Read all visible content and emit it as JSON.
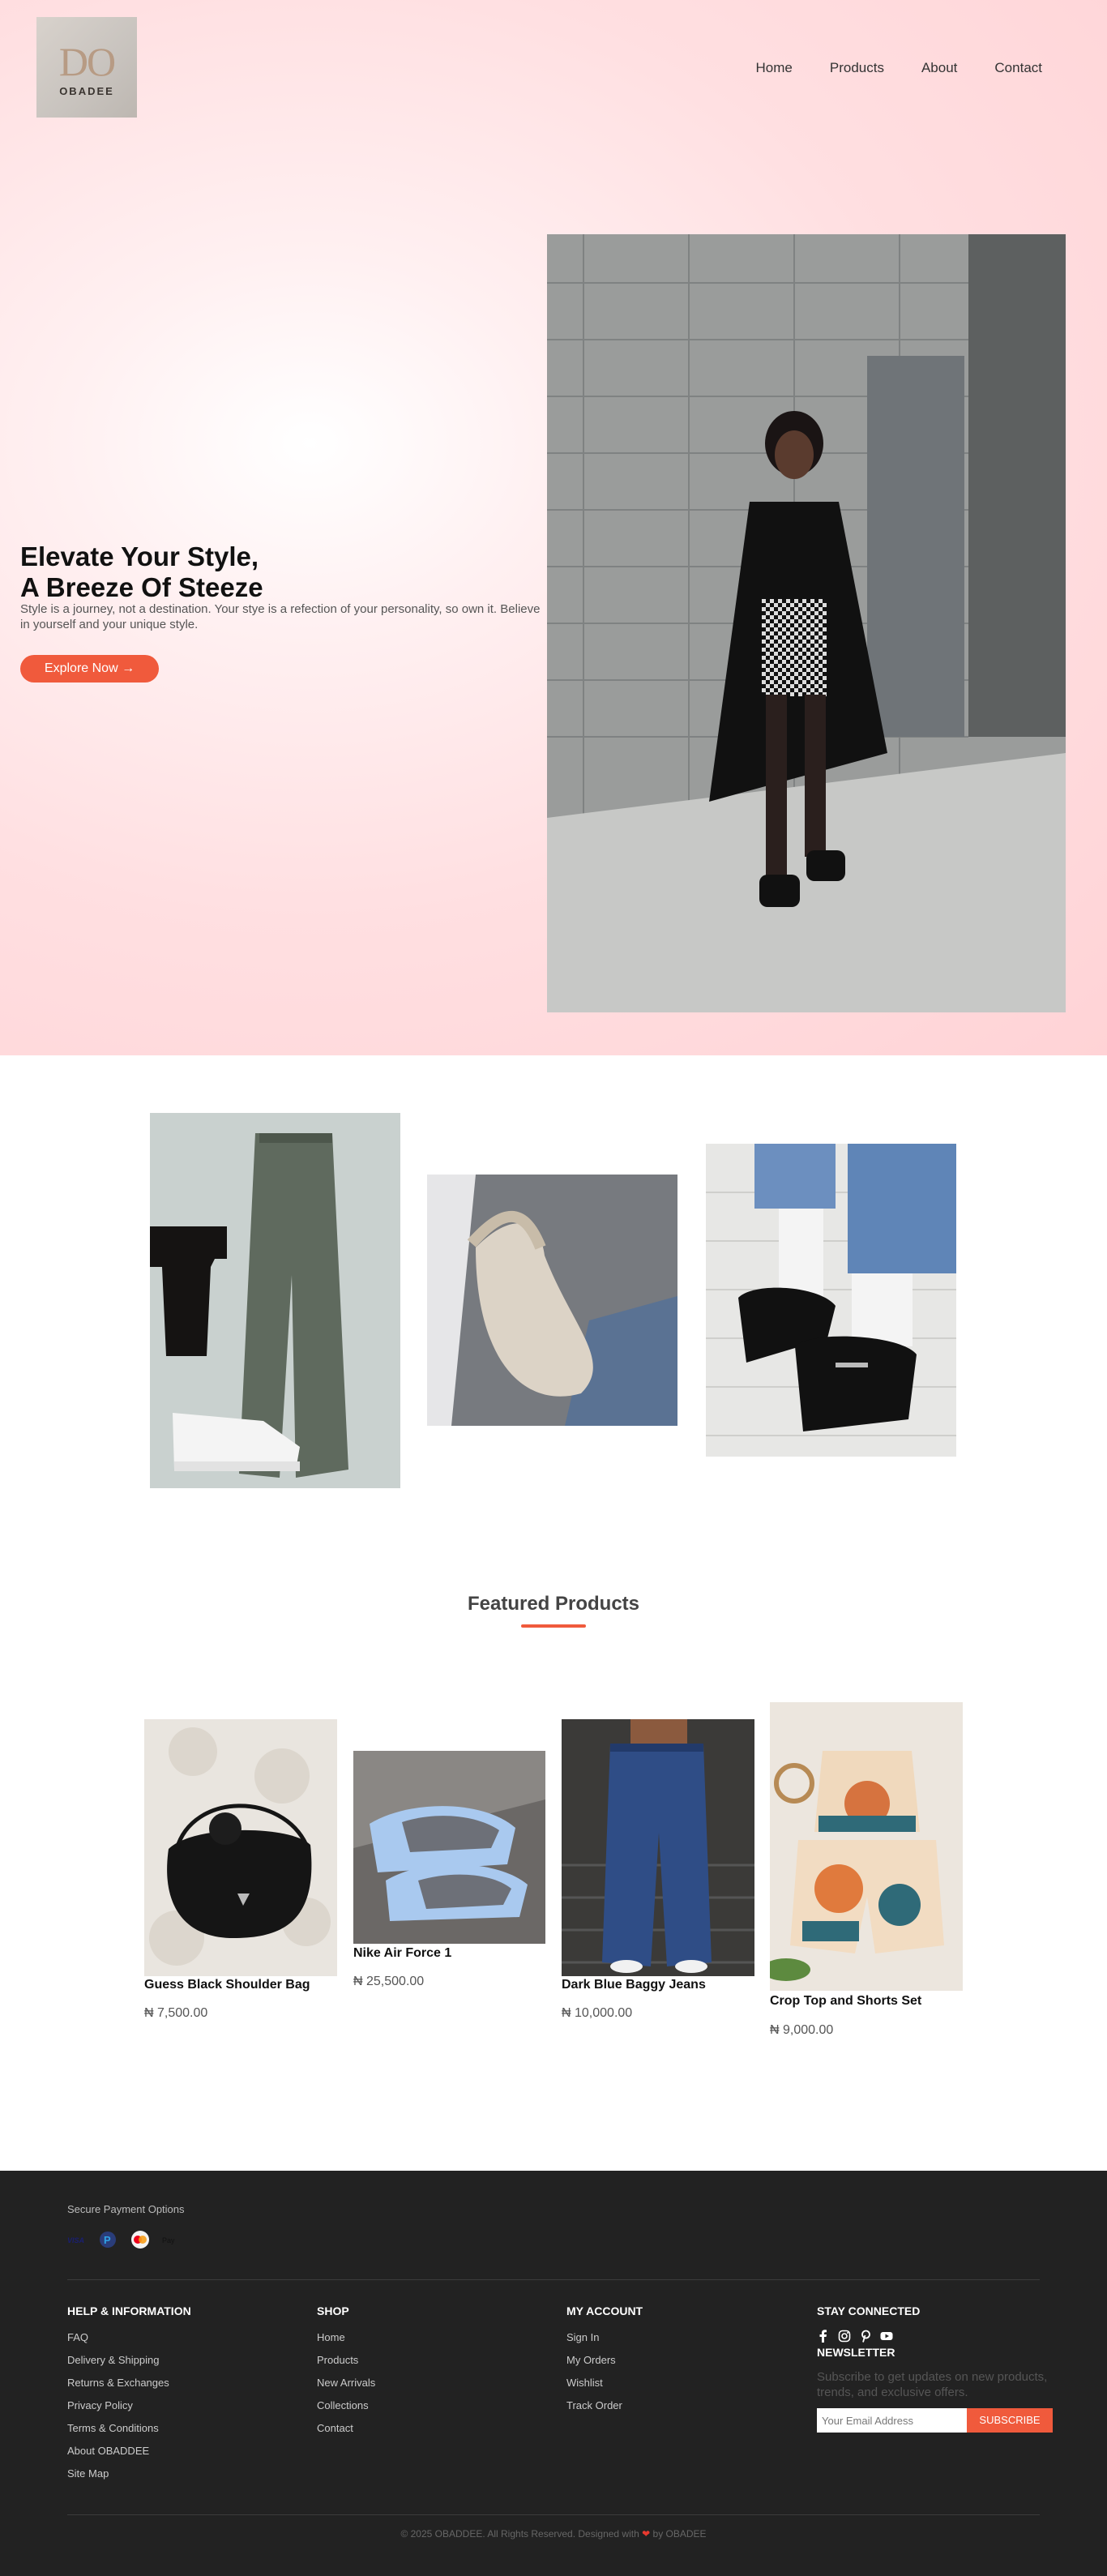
{
  "header": {
    "logo_monogram": "DO",
    "logo_brand": "OBADEE",
    "nav": [
      "Home",
      "Products",
      "About",
      "Contact"
    ]
  },
  "hero": {
    "title_line1": "Elevate Your Style,",
    "title_line2": "A Breeze Of Steeze",
    "subtitle": "Style is a journey, not a destination. Your stye is a refection of your personality, so own it. Believe in yourself and your unique style.",
    "cta": "Explore Now →"
  },
  "gallery": [
    "cargo-pants-outfit",
    "white-shoulder-bag",
    "black-loafers"
  ],
  "featured": {
    "title": "Featured Products",
    "products": [
      {
        "name": "Guess Black Shoulder Bag",
        "price": "₦ 7,500.00"
      },
      {
        "name": "Nike Air Force 1",
        "price": "₦ 25,500.00"
      },
      {
        "name": "Dark Blue Baggy Jeans",
        "price": "₦ 10,000.00"
      },
      {
        "name": "Crop Top and Shorts Set",
        "price": "₦ 9,000.00"
      }
    ]
  },
  "footer": {
    "secure_label": "Secure Payment Options",
    "payment_icons": [
      "visa-icon",
      "paypal-icon",
      "mastercard-icon",
      "apple-pay-icon"
    ],
    "help": {
      "title": "HELP & INFORMATION",
      "links": [
        "FAQ",
        "Delivery & Shipping",
        "Returns & Exchanges",
        "Privacy Policy",
        "Terms & Conditions",
        "About OBADDEE",
        "Site Map"
      ]
    },
    "shop": {
      "title": "SHOP",
      "links": [
        "Home",
        "Products",
        "New Arrivals",
        "Collections",
        "Contact"
      ]
    },
    "account": {
      "title": "MY ACCOUNT",
      "links": [
        "Sign In",
        "My Orders",
        "Wishlist",
        "Track Order"
      ]
    },
    "connect": {
      "title": "STAY CONNECTED",
      "social_icons": [
        "facebook-icon",
        "instagram-icon",
        "pinterest-icon",
        "youtube-icon"
      ]
    },
    "newsletter": {
      "title": "NEWSLETTER",
      "text": "Subscribe to get updates on new products, trends, and exclusive offers.",
      "placeholder": "Your Email Address",
      "button": "SUBSCRIBE"
    },
    "copyright_pre": "© 2025 OBADDEE. All Rights Reserved. Designed with",
    "copyright_post": "by OBADEE"
  },
  "colors": {
    "accent": "#f05a3c",
    "footer_bg": "#222222",
    "hero_pink": "#ffd3d6"
  }
}
